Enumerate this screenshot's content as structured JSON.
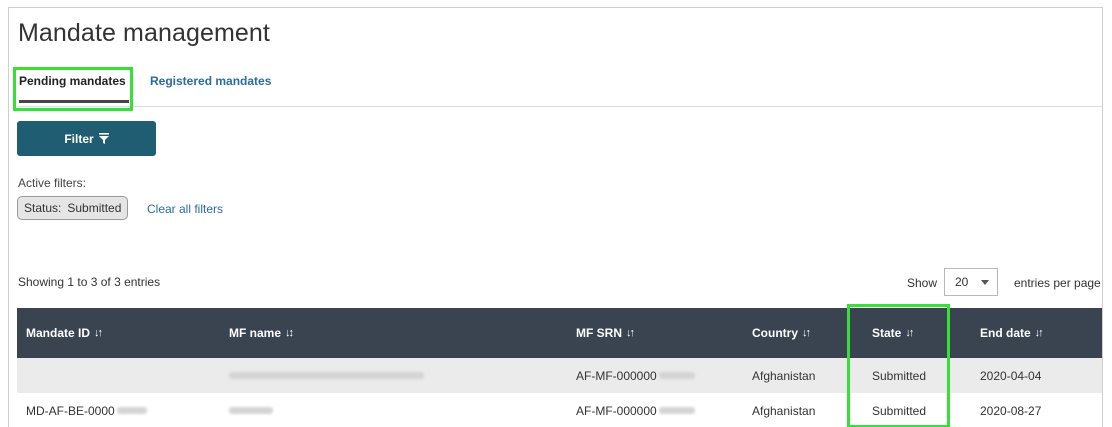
{
  "page": {
    "title": "Mandate management"
  },
  "tabs": [
    {
      "label": "Pending mandates",
      "active": true
    },
    {
      "label": "Registered mandates",
      "active": false
    }
  ],
  "filter": {
    "button_label": "Filter",
    "button_icon": "funnel-icon",
    "active_label": "Active filters:",
    "chip_key": "Status:",
    "chip_value": "Submitted",
    "clear_label": "Clear all filters"
  },
  "table_info": {
    "showing": "Showing 1 to 3 of 3 entries",
    "show_label": "Show",
    "page_size": "20",
    "per_page_label": "entries per page"
  },
  "table": {
    "columns": [
      {
        "label": "Mandate ID",
        "sort": "sort-icon"
      },
      {
        "label": "MF name",
        "sort": "sort-alpha-icon"
      },
      {
        "label": "MF SRN",
        "sort": "sort-icon"
      },
      {
        "label": "Country",
        "sort": "sort-icon"
      },
      {
        "label": "State",
        "sort": "sort-icon"
      },
      {
        "label": "End date",
        "sort": "sort-icon"
      }
    ],
    "rows": [
      {
        "mandate_id": "",
        "mf_srn": "AF-MF-000000",
        "country": "Afghanistan",
        "state": "Submitted",
        "end_date": "2020-04-04"
      },
      {
        "mandate_id": "MD-AF-BE-0000",
        "mf_srn": "AF-MF-000000",
        "country": "Afghanistan",
        "state": "Submitted",
        "end_date": "2020-08-27"
      }
    ]
  },
  "colors": {
    "header_bg": "#3a4350",
    "filter_bg": "#1f5e72",
    "link": "#2a6ba3",
    "highlight": "#37e037"
  }
}
